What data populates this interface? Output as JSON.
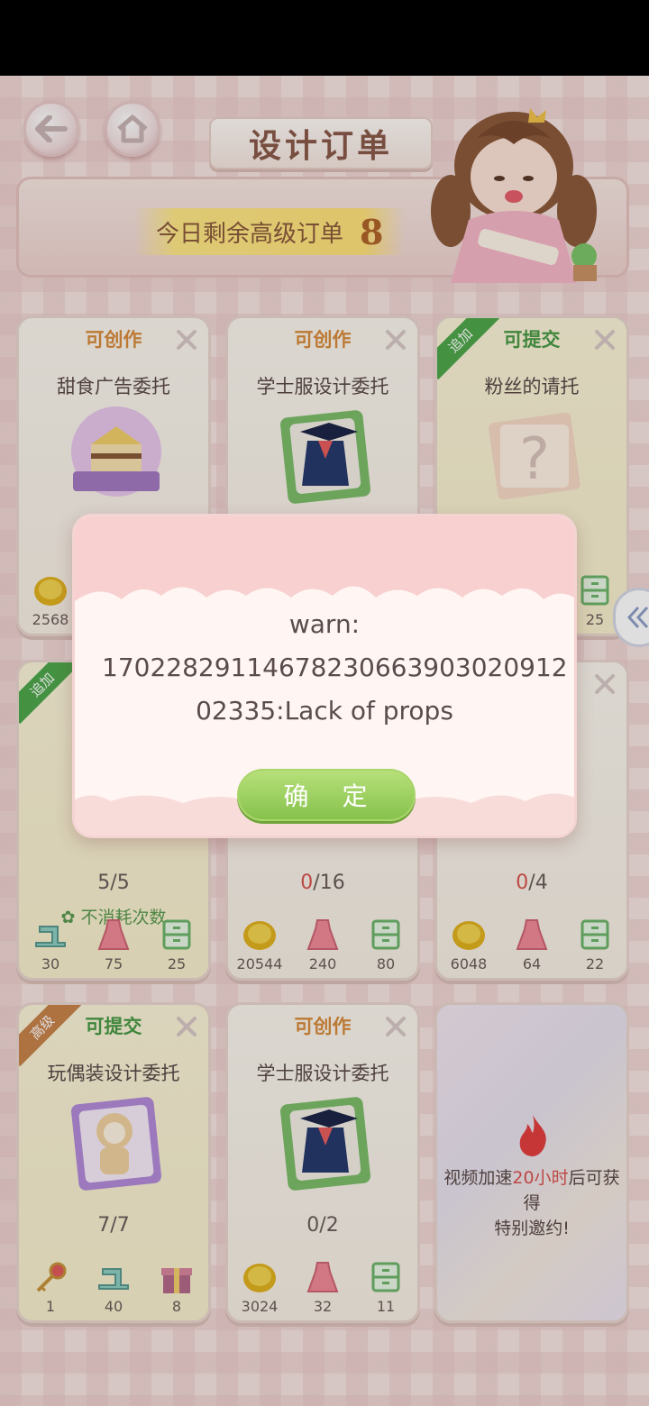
{
  "header": {
    "title": "设计订单",
    "remaining_label": "今日剩余高级订单",
    "remaining_count": "8"
  },
  "cards": [
    {
      "status": "可创作",
      "title": "甜食广告委托",
      "rewards": [
        "2568"
      ]
    },
    {
      "status": "可创作",
      "title": "学士服设计委托"
    },
    {
      "status": "可提交",
      "ribbon": "追加",
      "title": "粉丝的请托",
      "rewards": [
        "25"
      ]
    },
    {
      "ribbon": "追加",
      "progress": "5/5",
      "hint": "不消耗次数",
      "rewards": [
        "30",
        "75",
        "25"
      ]
    },
    {
      "progress_cur": "0",
      "progress_total": "/16",
      "rewards": [
        "20544",
        "240",
        "80"
      ]
    },
    {
      "progress_cur": "0",
      "progress_total": "/4",
      "rewards": [
        "6048",
        "64",
        "22"
      ]
    },
    {
      "status": "可提交",
      "ribbon": "高级",
      "title": "玩偶装设计委托",
      "progress": "7/7",
      "rewards": [
        "1",
        "40",
        "8"
      ]
    },
    {
      "status": "可创作",
      "title": "学士服设计委托",
      "progress": "0/2",
      "rewards": [
        "3024",
        "32",
        "11"
      ]
    },
    {
      "locked_pre": "视频加速",
      "locked_hl": "20小时",
      "locked_post": "后可获得",
      "locked_line2": "特别邀约!"
    }
  ],
  "dialog": {
    "line1": "warn:",
    "line2": "17022829114678230663903020912",
    "line3": "02335:Lack of props",
    "ok_label": "确 定"
  },
  "colors": {
    "accent_green": "#86c24c",
    "status_orange": "#d88b3c",
    "status_green": "#4a9a46"
  }
}
